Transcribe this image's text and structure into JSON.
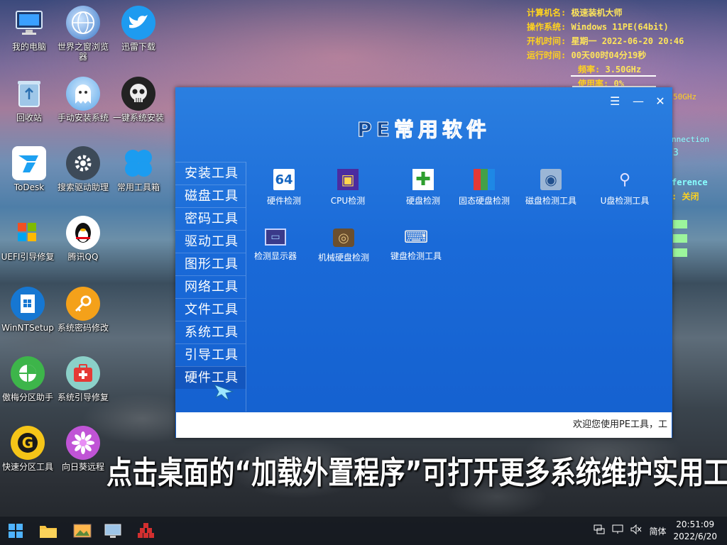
{
  "desktop": {
    "icons": [
      {
        "label": "我的电脑",
        "icon": "computer-icon"
      },
      {
        "label": "世界之窗浏览器",
        "icon": "browser-globe-icon"
      },
      {
        "label": "迅雷下载",
        "icon": "thunder-bird-icon"
      },
      {
        "label": "回收站",
        "icon": "recycle-bin-icon"
      },
      {
        "label": "手动安装系统",
        "icon": "ghost-icon"
      },
      {
        "label": "一键系统安装",
        "icon": "ghost-skull-icon"
      },
      {
        "label": "ToDesk",
        "icon": "todesk-icon"
      },
      {
        "label": "搜索驱动助理",
        "icon": "gear-icon"
      },
      {
        "label": "常用工具箱",
        "icon": "clover-icon"
      },
      {
        "label": "UEFI引导修复",
        "icon": "windows-flag-icon"
      },
      {
        "label": "腾讯QQ",
        "icon": "qq-penguin-icon"
      },
      {
        "label": "WinNTSetup",
        "icon": "winntsetup-icon"
      },
      {
        "label": "系统密码修改",
        "icon": "key-icon"
      },
      {
        "label": "傲梅分区助手",
        "icon": "partition-icon"
      },
      {
        "label": "系统引导修复",
        "icon": "first-aid-icon"
      },
      {
        "label": "快速分区工具",
        "icon": "g-partition-icon"
      },
      {
        "label": "向日葵远程",
        "icon": "sunflower-icon"
      }
    ]
  },
  "sysinfo": {
    "computer_name_label": "计算机名:",
    "computer_name": "极速装机大师",
    "os_label": "操作系统:",
    "os": "Windows 11PE(64bit)",
    "boot_time_label": "开机时间:",
    "boot_time": "星期一 2022-06-20 20:46",
    "uptime_label": "运行时间:",
    "uptime": "00天00时04分19秒",
    "freq_label": "频率:",
    "freq": "3.50GHz",
    "usage_label": "使用率:",
    "usage": "0%",
    "frag_ghz": "50GHz",
    "frag_connection": "nnection",
    "frag_3": "3",
    "frag_ference": "ference",
    "frag_close": ": 关闭"
  },
  "pe_window": {
    "title": "PE常用软件",
    "controls": {
      "menu": "☰",
      "minimize": "—",
      "close": "✕"
    },
    "sidebar": [
      "安装工具",
      "磁盘工具",
      "密码工具",
      "驱动工具",
      "图形工具",
      "网络工具",
      "文件工具",
      "系统工具",
      "引导工具",
      "硬件工具"
    ],
    "active_index": 9,
    "tools": [
      {
        "label": "硬件检测",
        "icon": "64-icon",
        "glyph": "64"
      },
      {
        "label": "CPU检测",
        "icon": "cpu-chip-icon",
        "glyph": "▣"
      },
      {
        "label": "硬盘检测",
        "icon": "green-cross-icon",
        "glyph": "✚"
      },
      {
        "label": "固态硬盘检测",
        "icon": "ssd-color-icon",
        "glyph": "▦"
      },
      {
        "label": "磁盘检测工具",
        "icon": "disk-scan-icon",
        "glyph": "◉"
      },
      {
        "label": "U盘检测工具",
        "icon": "usb-magnifier-icon",
        "glyph": "⚲"
      },
      {
        "label": "检测显示器",
        "icon": "monitor-icon",
        "glyph": "▭"
      },
      {
        "label": "机械硬盘检测",
        "icon": "hdd-icon",
        "glyph": "◎"
      },
      {
        "label": "键盘检测工具",
        "icon": "keyboard-icon",
        "glyph": "⌨"
      }
    ],
    "status": "欢迎您使用PE工具，工"
  },
  "banner": "点击桌面的“加载外置程序”可打开更多系统维护实用工具",
  "taskbar": {
    "ime": "简体",
    "time": "20:51:09",
    "date": "2022/6/20"
  }
}
